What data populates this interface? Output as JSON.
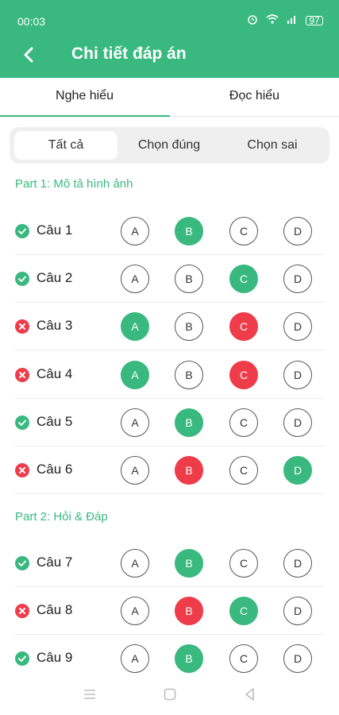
{
  "status_bar": {
    "time": "00:03",
    "battery": "97"
  },
  "header": {
    "title": "Chi tiết đáp án"
  },
  "main_tabs": [
    {
      "label": "Nghe hiểu",
      "active": true
    },
    {
      "label": "Đọc hiểu",
      "active": false
    }
  ],
  "filters": [
    {
      "label": "Tất cả",
      "active": true
    },
    {
      "label": "Chọn đúng",
      "active": false
    },
    {
      "label": "Chọn sai",
      "active": false
    }
  ],
  "sections": [
    {
      "title": "Part 1: Mô tả hình ảnh",
      "questions": [
        {
          "label": "Câu 1",
          "status": "correct",
          "options": [
            "A",
            "B",
            "C",
            "D"
          ],
          "states": [
            "none",
            "correct",
            "none",
            "none"
          ]
        },
        {
          "label": "Câu 2",
          "status": "correct",
          "options": [
            "A",
            "B",
            "C",
            "D"
          ],
          "states": [
            "none",
            "none",
            "correct",
            "none"
          ]
        },
        {
          "label": "Câu 3",
          "status": "wrong",
          "options": [
            "A",
            "B",
            "C",
            "D"
          ],
          "states": [
            "correct",
            "none",
            "wrong",
            "none"
          ]
        },
        {
          "label": "Câu 4",
          "status": "wrong",
          "options": [
            "A",
            "B",
            "C",
            "D"
          ],
          "states": [
            "correct",
            "none",
            "wrong",
            "none"
          ]
        },
        {
          "label": "Câu 5",
          "status": "correct",
          "options": [
            "A",
            "B",
            "C",
            "D"
          ],
          "states": [
            "none",
            "correct",
            "none",
            "none"
          ]
        },
        {
          "label": "Câu 6",
          "status": "wrong",
          "options": [
            "A",
            "B",
            "C",
            "D"
          ],
          "states": [
            "none",
            "wrong",
            "none",
            "correct"
          ]
        }
      ]
    },
    {
      "title": "Part 2: Hỏi & Đáp",
      "questions": [
        {
          "label": "Câu 7",
          "status": "correct",
          "options": [
            "A",
            "B",
            "C",
            "D"
          ],
          "states": [
            "none",
            "correct",
            "none",
            "none"
          ]
        },
        {
          "label": "Câu 8",
          "status": "wrong",
          "options": [
            "A",
            "B",
            "C",
            "D"
          ],
          "states": [
            "none",
            "wrong",
            "correct",
            "none"
          ]
        },
        {
          "label": "Câu 9",
          "status": "correct",
          "options": [
            "A",
            "B",
            "C",
            "D"
          ],
          "states": [
            "none",
            "correct",
            "none",
            "none"
          ]
        }
      ]
    }
  ],
  "colors": {
    "accent": "#39b97f",
    "wrong": "#ef3c4a"
  }
}
